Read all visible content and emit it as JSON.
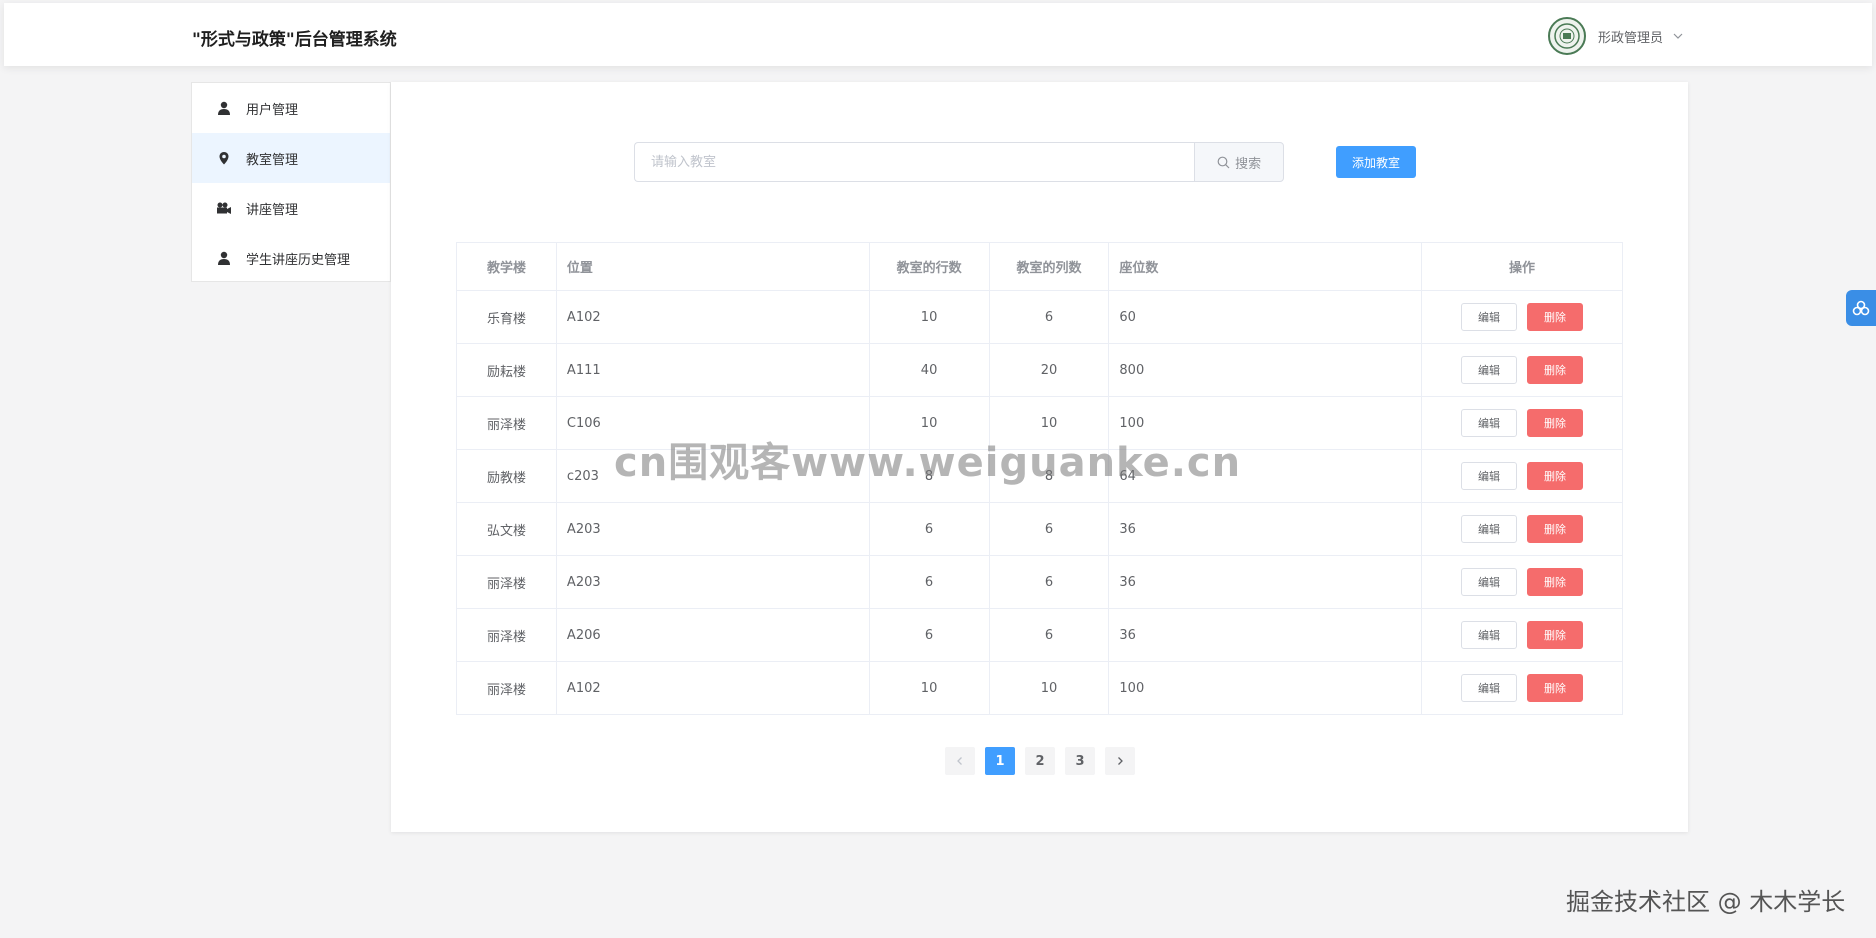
{
  "header": {
    "app_title": "\"形式与政策\"后台管理系统",
    "user_name": "形政管理员"
  },
  "sidebar": {
    "items": [
      {
        "label": "用户管理",
        "icon": "user-icon"
      },
      {
        "label": "教室管理",
        "icon": "location-icon",
        "active": true
      },
      {
        "label": "讲座管理",
        "icon": "video-camera-icon"
      },
      {
        "label": "学生讲座历史管理",
        "icon": "user-icon"
      }
    ]
  },
  "search": {
    "placeholder": "请输入教室",
    "value": "",
    "button_label": "搜索"
  },
  "add_button_label": "添加教室",
  "table": {
    "headers": [
      "教学楼",
      "位置",
      "教室的行数",
      "教室的列数",
      "座位数",
      "操作"
    ],
    "rows": [
      [
        "乐育楼",
        "A102",
        "10",
        "6",
        "60"
      ],
      [
        "励耘楼",
        "A111",
        "40",
        "20",
        "800"
      ],
      [
        "丽泽楼",
        "C106",
        "10",
        "10",
        "100"
      ],
      [
        "励教楼",
        "c203",
        "8",
        "8",
        "64"
      ],
      [
        "弘文楼",
        "A203",
        "6",
        "6",
        "36"
      ],
      [
        "丽泽楼",
        "A203",
        "6",
        "6",
        "36"
      ],
      [
        "丽泽楼",
        "A206",
        "6",
        "6",
        "36"
      ],
      [
        "丽泽楼",
        "A102",
        "10",
        "10",
        "100"
      ]
    ],
    "edit_label": "编辑",
    "delete_label": "删除"
  },
  "pagination": {
    "pages": [
      "1",
      "2",
      "3"
    ],
    "current": "1"
  },
  "watermarks": {
    "center": "cn围观客www.weiguanke.cn",
    "bottom": "掘金技术社区 @ 木木学长"
  },
  "colors": {
    "primary": "#409eff",
    "danger": "#f56c6c",
    "active_bg": "#ecf5ff"
  }
}
